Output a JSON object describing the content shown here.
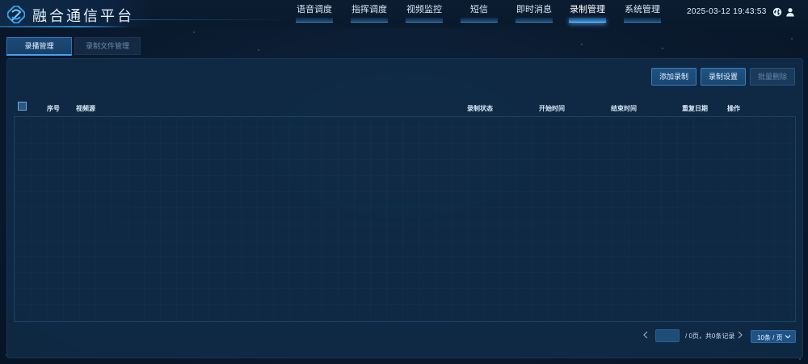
{
  "app": {
    "title": "融合通信平台"
  },
  "nav": {
    "items": [
      {
        "label": "语音调度"
      },
      {
        "label": "指挥调度"
      },
      {
        "label": "视频监控"
      },
      {
        "label": "短信"
      },
      {
        "label": "即时消息"
      },
      {
        "label": "录制管理",
        "active": true
      },
      {
        "label": "系统管理"
      }
    ]
  },
  "header": {
    "datetime": "2025-03-12 19:43:53",
    "icons": [
      "globe-icon",
      "user-icon"
    ]
  },
  "subtabs": [
    {
      "label": "录播管理",
      "active": true
    },
    {
      "label": "录制文件管理"
    }
  ],
  "toolbar": {
    "add_label": "添加录制",
    "settings_label": "录制设置",
    "batch_delete_label": "批量删除"
  },
  "table": {
    "columns": [
      "序号",
      "视频源",
      "录制状态",
      "开始时间",
      "结束时间",
      "重复日期",
      "操作"
    ],
    "rows": []
  },
  "pagination": {
    "current_page": "",
    "info": "/ 0页，共0条记录",
    "page_size_label": "10条 / 页"
  },
  "colors": {
    "accent": "#49a3ea",
    "background": "#0a1a2e",
    "panel": "#102c48"
  }
}
